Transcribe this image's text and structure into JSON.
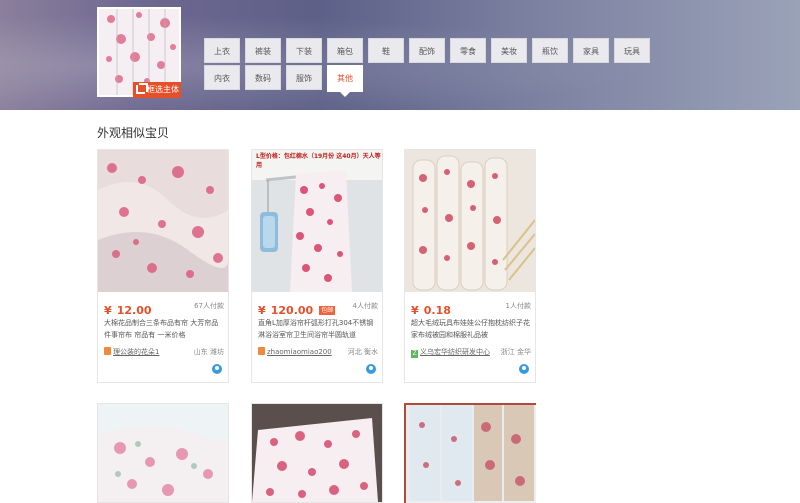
{
  "query": {
    "select_main_label": "框选主体"
  },
  "categories": [
    {
      "label": "上衣",
      "active": false
    },
    {
      "label": "裤装",
      "active": false
    },
    {
      "label": "下装",
      "active": false
    },
    {
      "label": "箱包",
      "active": false
    },
    {
      "label": "鞋",
      "active": false
    },
    {
      "label": "配饰",
      "active": false
    },
    {
      "label": "零食",
      "active": false
    },
    {
      "label": "美妆",
      "active": false
    },
    {
      "label": "瓶饮",
      "active": false
    },
    {
      "label": "家具",
      "active": false
    },
    {
      "label": "玩具",
      "active": false
    },
    {
      "label": "内衣",
      "active": false
    },
    {
      "label": "数码",
      "active": false
    },
    {
      "label": "服饰",
      "active": false
    },
    {
      "label": "其他",
      "active": true
    }
  ],
  "section_title": "外观相似宝贝",
  "products": [
    {
      "price_symbol": "¥",
      "price": "12.00",
      "tag": "",
      "sales": "67人付款",
      "title": "大棉花品制合三条布品有帘 大芳帘品件事帘布 帘品有 一米价格",
      "shop_icon": "shop",
      "shop": "理公装的花朵1",
      "location": "山东 潍坊"
    },
    {
      "price_symbol": "¥",
      "price": "120.00",
      "tag": "包邮",
      "sales": "4人付款",
      "title": "直角L加厚浴帘杆弧形打孔304不锈钢淋浴浴室帘卫生间浴帘半圆轨道",
      "shop_icon": "shop",
      "shop": "zhaomiaomiao200",
      "location": "河北 衡水",
      "img_text": "L型价格：包红棉水（19月份 这40月）天人等用"
    },
    {
      "price_symbol": "¥",
      "price": "0.18",
      "tag": "",
      "sales": "1人付款",
      "title": "超大毛绒玩具布娃娃公仔抱枕纺织子花家布绒被园和棉服礼品被",
      "shop_icon": "tmall",
      "shop": "义乌宏华纺织研发中心",
      "location": "浙江 金华"
    }
  ],
  "colors": {
    "accent": "#e5502a",
    "header_gradient_start": "#8a7f9c",
    "header_gradient_end": "#9aa2b8"
  }
}
